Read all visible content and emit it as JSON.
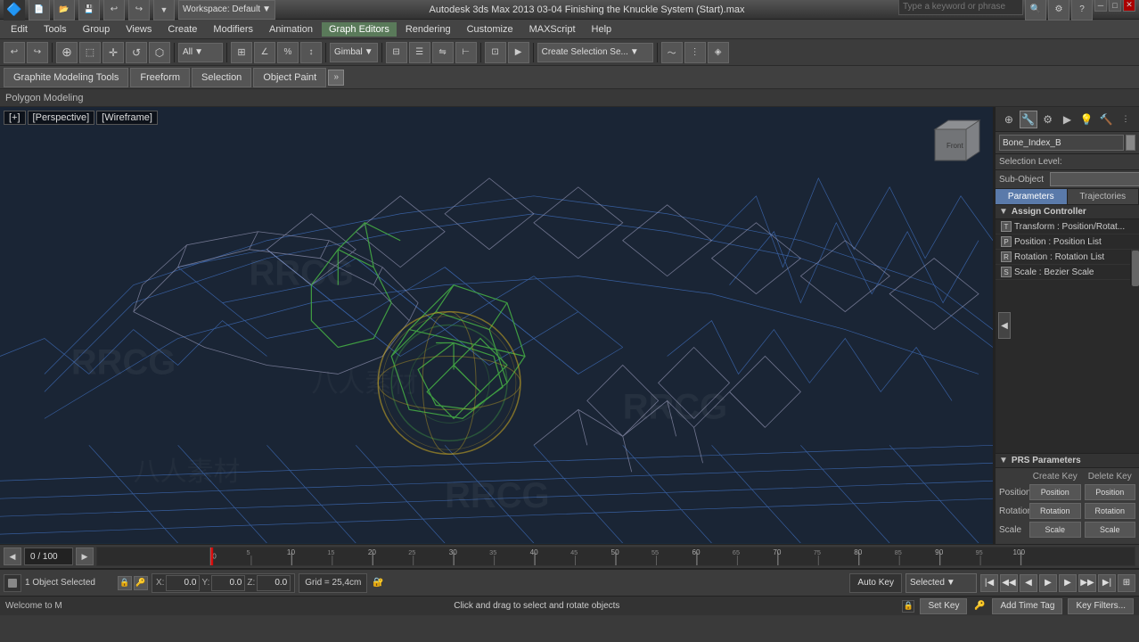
{
  "titlebar": {
    "app_icon": "3dsmax-icon",
    "workspace_label": "Workspace: Default",
    "title": "Autodesk 3ds Max 2013    03-04 Finishing the Knuckle System (Start).max",
    "search_placeholder": "Type a keyword or phrase",
    "minimize_label": "─",
    "maximize_label": "□",
    "close_label": "✕"
  },
  "menubar": {
    "items": [
      {
        "label": "Edit",
        "active": false
      },
      {
        "label": "Tools",
        "active": false
      },
      {
        "label": "Group",
        "active": false
      },
      {
        "label": "Views",
        "active": false
      },
      {
        "label": "Create",
        "active": false
      },
      {
        "label": "Modifiers",
        "active": false
      },
      {
        "label": "Animation",
        "active": false
      },
      {
        "label": "Graph Editors",
        "active": true
      },
      {
        "label": "Rendering",
        "active": false
      },
      {
        "label": "Customize",
        "active": false
      },
      {
        "label": "MAXScript",
        "active": false
      },
      {
        "label": "Help",
        "active": false
      }
    ]
  },
  "toolbar1": {
    "filter_label": "All",
    "transform_label": "Gimbal",
    "selection_set_label": "Create Selection Se...",
    "icons": [
      "undo-icon",
      "redo-icon",
      "select-icon",
      "move-icon",
      "rotate-icon",
      "scale-icon",
      "snap-icon"
    ]
  },
  "toolbar2": {
    "tabs": [
      {
        "label": "Graphite Modeling Tools"
      },
      {
        "label": "Freeform"
      },
      {
        "label": "Selection"
      },
      {
        "label": "Object Paint"
      }
    ],
    "expand_label": "»"
  },
  "breadcrumb": {
    "label": "Polygon Modeling"
  },
  "viewport": {
    "labels": [
      "[+]",
      "[Perspective]",
      "[Wireframe]"
    ],
    "background_color": "#1a2535"
  },
  "right_panel": {
    "tabs": [
      "create-icon",
      "modify-icon",
      "hierarchy-icon",
      "motion-icon",
      "display-icon",
      "utilities-icon"
    ],
    "object_name": "Bone_Index_B",
    "color_swatch": "#888888",
    "selection_level_label": "Selection Level:",
    "sub_object_label": "Sub-Object",
    "panel_tabs": [
      {
        "label": "Parameters",
        "active": true
      },
      {
        "label": "Trajectories",
        "active": false
      }
    ],
    "assign_controller": {
      "header": "Assign Controller",
      "items": [
        {
          "label": "Transform : Position/Rotat...",
          "icon": "transform-icon"
        },
        {
          "label": "Position : Position List",
          "icon": "position-icon"
        },
        {
          "label": "Rotation : Rotation List",
          "icon": "rotation-icon"
        },
        {
          "label": "Scale : Bezier Scale",
          "icon": "scale-icon"
        }
      ]
    },
    "prs": {
      "header": "PRS Parameters",
      "create_key_label": "Create Key",
      "delete_key_label": "Delete Key",
      "position_label": "Position",
      "rotation_label": "Rotation",
      "scale_label": "Scale"
    }
  },
  "timeline": {
    "frame_display": "0 / 100",
    "markers": [
      "0",
      "5",
      "10",
      "15",
      "20",
      "25",
      "30",
      "35",
      "40",
      "45",
      "50",
      "55",
      "60",
      "65",
      "70",
      "75",
      "80",
      "85",
      "90",
      "95",
      "100"
    ]
  },
  "status_bar": {
    "object_count": "1 Object Selected",
    "hint": "Click and drag to select and rotate objects",
    "x_label": "X:",
    "x_value": "0.0",
    "y_label": "Y:",
    "y_value": "0.0",
    "z_label": "Z:",
    "z_value": "0.0",
    "grid_label": "Grid = 25,4cm",
    "auto_key_label": "Auto Key",
    "selected_label": "Selected",
    "set_key_label": "Set Key",
    "add_time_tag_label": "Add Time Tag",
    "key_filters_label": "Key Filters..."
  },
  "anim_controls": {
    "go_start": "|◀",
    "prev_frame": "◀",
    "play": "▶",
    "next_frame": "▶",
    "go_end": "▶|",
    "key_mode": "⊞"
  }
}
